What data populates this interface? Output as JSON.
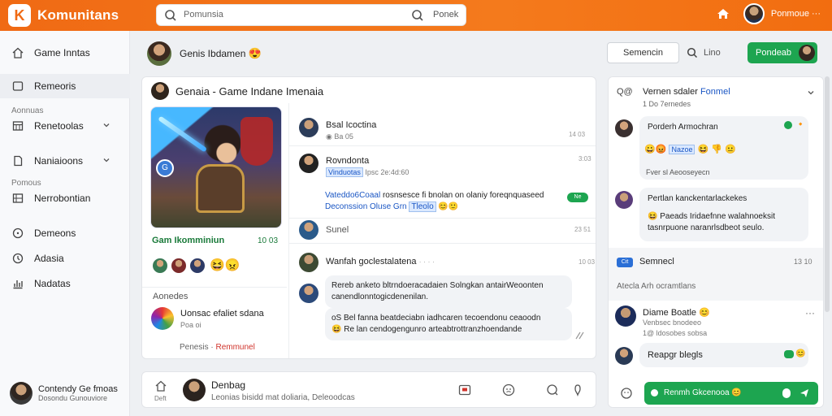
{
  "app": {
    "name": "Komunitans",
    "logo_letter": "K"
  },
  "topbar": {
    "search_placeholder": "Pomunsia",
    "search_button": "Ponek",
    "user_name": "Ponmoue ···"
  },
  "sidebar": {
    "items": [
      {
        "label": "Game Inntas",
        "icon": "home-icon"
      },
      {
        "label": "Remeoris",
        "icon": "square-icon"
      },
      {
        "label": "Renetoolas",
        "icon": "calendar-icon"
      },
      {
        "label": "Naniaioons",
        "icon": "document-icon"
      },
      {
        "label": "Nerrobontian",
        "icon": "grid-icon"
      },
      {
        "label": "Demeons",
        "icon": "clock-icon"
      },
      {
        "label": "Adasia",
        "icon": "settings-icon"
      },
      {
        "label": "Nadatas",
        "icon": "chart-icon"
      }
    ],
    "sections": [
      "Aonnuas",
      "Pomous"
    ],
    "user": {
      "name": "Contendy Ge fmoas",
      "sub": "Dosondu Gunouviore"
    }
  },
  "header": {
    "title": "Genis Ibdamen",
    "title_emoji": "😍",
    "outline_button": "Semencin",
    "search_label": "Lino",
    "green_button": "Pondeab"
  },
  "panel": {
    "title": "Genaia - Game Indane Imenaia",
    "game": {
      "name": "Gam Ikomminiun",
      "count": "10 03",
      "badge": "G"
    },
    "members_emoji": "😆😠",
    "section_label": "Aonedes",
    "game2": {
      "title": "Uonsac efaliet sdana",
      "sub": "Poa oi",
      "foot": "Penesis ·",
      "foot_red": "Remmunel"
    },
    "messages": {
      "m1": {
        "name": "Bsal Icoctina",
        "sub": "Ba 05",
        "badge": "Ne",
        "time": "14 03"
      },
      "m2": {
        "name": "Rovndonta",
        "tag": "Vinduotas",
        "sub": "Ipsc 2e:4d:60",
        "time": "3:03",
        "line1_blue": "Vateddo6Coaal",
        "line1": " rosnsesce fi bnolan on olaniy foreqnquaseed",
        "line2_blue": "Deconssion Oluse Grn",
        "line2_tag": "Tleolo",
        "line2_emoji": "😊🙂"
      },
      "m3": {
        "name": "Sunel",
        "time": "23 51"
      },
      "m4": {
        "name": "Wanfah goclestalatena",
        "sub": "· · · ·",
        "time": "10 03",
        "b1l1": "Rereb anketo bltrndoeracadaien Solngkan antairWeoonten",
        "b1l2": "canendlonntogicdenenilan.",
        "b2l1": "oS Bel fanna beatdeciabn iadhcaren tecoendonu ceaoodn",
        "b2l2": "Re lan cendogengunro arteabtrottranzhoendande",
        "b2_emoji": "😆"
      }
    }
  },
  "composer": {
    "home_label": "Deft",
    "name": "Denbag",
    "text": "Leonias bisidd mat doliaria, Deleoodcas"
  },
  "right": {
    "head_icon": "Q@",
    "head_title": "Vernen sdaler",
    "head_title_blue": "Fonmel",
    "head_sub": "1 Do 7ernedes",
    "card1": {
      "text": "Porderh Armochran",
      "emoji_row": "😀😡",
      "tag": "Nazoe",
      "emoji_tail": "😆 👎 😐",
      "note": "Fver sl Aeooseyecn"
    },
    "card2": {
      "l1": "Pertlan kanckentarlackekes",
      "l2": "Paeads Iridaefnne walahnoeksit",
      "l3": "tasnrpuone naranrlsdbeot seulo."
    },
    "tag_row": {
      "tag": "Cit",
      "label": "Semnecl",
      "time": "13 10"
    },
    "section": "Atecla Arh ocramtlans",
    "card3": {
      "name": "Diame Boatle",
      "emoji": "😊",
      "sub": "Venbsec bnodeeo",
      "sub2": "1@ ldosobes sobsa"
    },
    "card4": {
      "text": "Reapgr blegls"
    },
    "composer_text": "Renmh Gkcenooa"
  },
  "colors": {
    "brand": "#f06a14",
    "green": "#1da550",
    "blue": "#1a56c4"
  }
}
